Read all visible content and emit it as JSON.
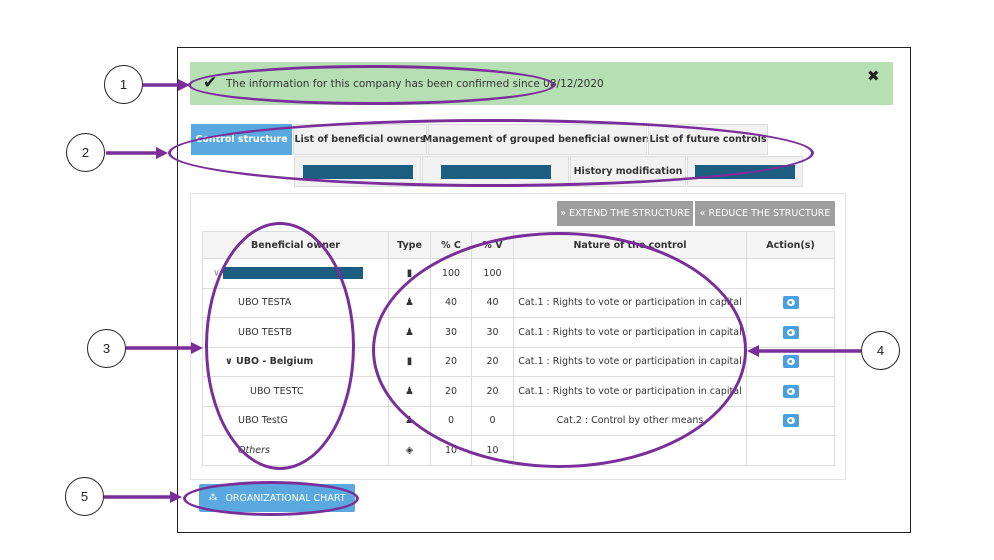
{
  "banner": {
    "text": "The information for this company has been confirmed since 08/12/2020",
    "check_icon": "check-icon",
    "close_icon": "close-icon",
    "close_glyph": "✖",
    "check_glyph": "✔"
  },
  "tabs": {
    "row1": [
      "Control structure",
      "List of beneficial owners",
      "Management of grouped beneficial owners",
      "List of future controls"
    ],
    "row2_history": "History modification"
  },
  "toolbar": {
    "extend": "» EXTEND THE STRUCTURE",
    "reduce": "« REDUCE THE STRUCTURE"
  },
  "table": {
    "headers": [
      "Beneficial owner",
      "Type",
      "% C",
      "% V",
      "Nature of the control",
      "Action(s)"
    ],
    "rows": [
      {
        "name": "",
        "redacted": true,
        "type_icon": "building-icon",
        "c": "100",
        "v": "100",
        "nature": "",
        "action": false
      },
      {
        "name": "UBO TESTA",
        "type_icon": "person-icon",
        "c": "40",
        "v": "40",
        "nature": "Cat.1 : Rights to vote or participation in capital",
        "action": true
      },
      {
        "name": "UBO TESTB",
        "type_icon": "person-icon",
        "c": "30",
        "v": "30",
        "nature": "Cat.1 : Rights to vote or participation in capital",
        "action": true
      },
      {
        "name": "UBO - Belgium",
        "type_icon": "building-icon",
        "c": "20",
        "v": "20",
        "nature": "Cat.1 : Rights to vote or participation in capital",
        "action": true
      },
      {
        "name": "UBO TESTC",
        "type_icon": "person-icon",
        "c": "20",
        "v": "20",
        "nature": "Cat.1 : Rights to vote or participation in capital",
        "action": true
      },
      {
        "name": "UBO TestG",
        "type_icon": "person-icon",
        "c": "0",
        "v": "0",
        "nature": "Cat.2 : Control by other means",
        "action": true
      },
      {
        "name": "Others",
        "type_icon": "eye-slash-icon",
        "c": "10",
        "v": "10",
        "nature": "",
        "action": false
      }
    ]
  },
  "org_chart_button": "ORGANIZATIONAL CHART",
  "callouts": [
    "1",
    "2",
    "3",
    "4",
    "5"
  ],
  "colors": {
    "annotation": "#7a2e99",
    "banner": "#b7dfb4",
    "accent": "#5aa8e0",
    "redacted": "#1b5e80"
  }
}
